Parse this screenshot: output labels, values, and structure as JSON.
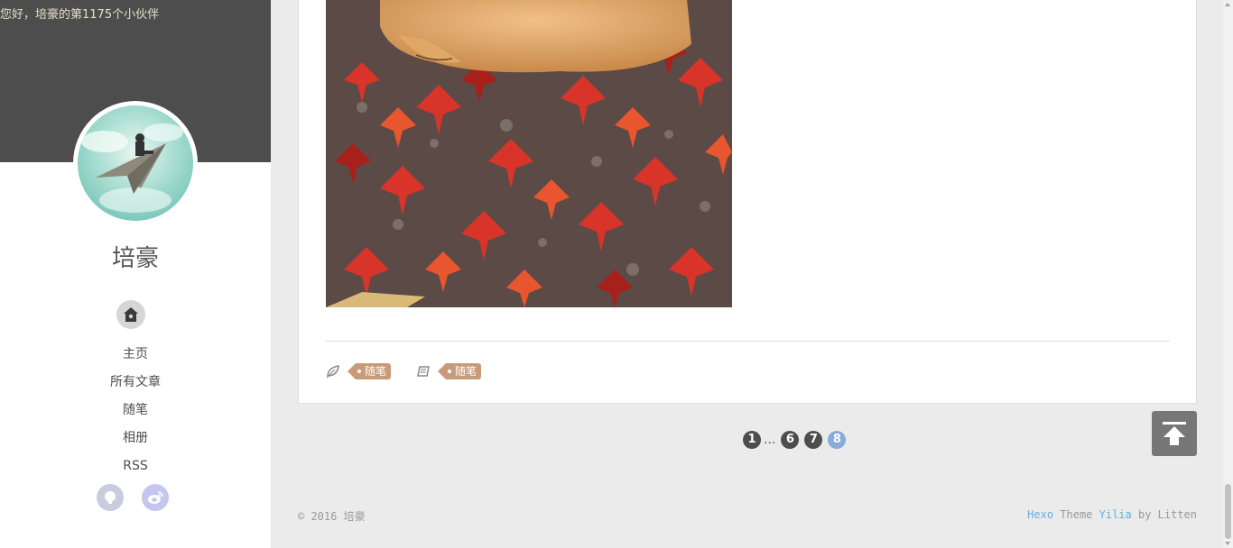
{
  "sidebar": {
    "greeting": "您好，培豪的第1175个小伙伴",
    "author_name": "培豪",
    "home_icon": "home-icon",
    "nav": [
      {
        "label": "主页"
      },
      {
        "label": "所有文章"
      },
      {
        "label": "随笔"
      },
      {
        "label": "相册"
      },
      {
        "label": "RSS"
      }
    ],
    "social": [
      {
        "icon": "github-icon"
      },
      {
        "icon": "weibo-icon"
      }
    ]
  },
  "article": {
    "tags": [
      {
        "icon": "leaf-tag-icon",
        "label": "随笔"
      },
      {
        "icon": "book-category-icon",
        "label": "随笔"
      }
    ]
  },
  "pagination": {
    "first": "1",
    "dots": "...",
    "pages": [
      "6",
      "7"
    ],
    "current": "8"
  },
  "footer": {
    "copyright": "© 2016 培豪",
    "credit_engine": "Hexo",
    "credit_theme_word": " Theme ",
    "credit_theme": "Yilia",
    "credit_by": " by Litten"
  },
  "colors": {
    "sidebar_header": "#4d4d4d",
    "tag": "#c79b7a",
    "page_current": "#88acdb",
    "link": "#66afd9"
  }
}
